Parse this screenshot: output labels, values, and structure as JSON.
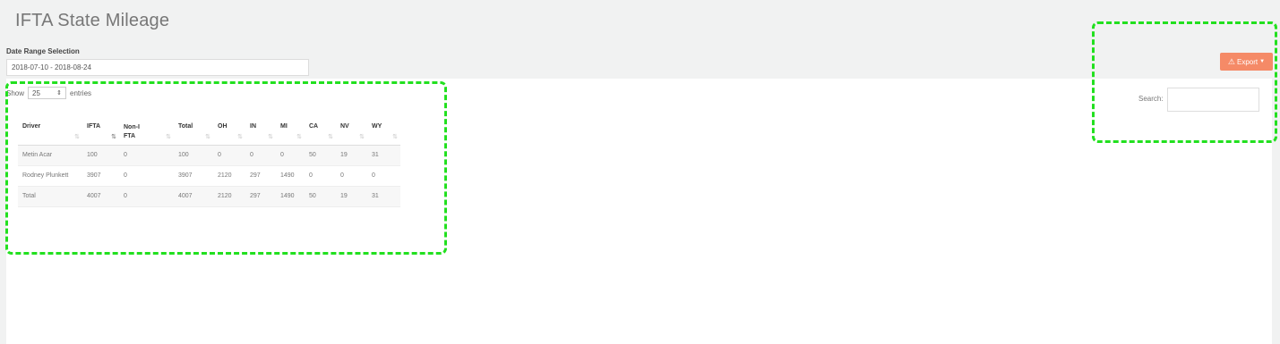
{
  "page": {
    "title": "IFTA State Mileage"
  },
  "filters": {
    "date_range_label": "Date Range Selection",
    "date_range_value": "2018-07-10 - 2018-08-24"
  },
  "toolbar": {
    "export_label": "Export",
    "export_icon": "warning-triangle-icon",
    "accent_color": "#f58a67"
  },
  "table_controls": {
    "show_label": "Show",
    "page_length": "25",
    "entries_label": "entries",
    "search_label": "Search:",
    "search_value": ""
  },
  "table": {
    "columns": [
      "Driver",
      "IFTA",
      "Non-IFTA",
      "Total",
      "OH",
      "IN",
      "MI",
      "CA",
      "NV",
      "WY"
    ],
    "rows": [
      [
        "Metin Acar",
        "100",
        "0",
        "100",
        "0",
        "0",
        "0",
        "50",
        "19",
        "31"
      ],
      [
        "Rodney Plunkett",
        "3907",
        "0",
        "3907",
        "2120",
        "297",
        "1490",
        "0",
        "0",
        "0"
      ],
      [
        "Total",
        "4007",
        "0",
        "4007",
        "2120",
        "297",
        "1490",
        "50",
        "19",
        "31"
      ]
    ]
  },
  "highlight_color": "#22e01f"
}
